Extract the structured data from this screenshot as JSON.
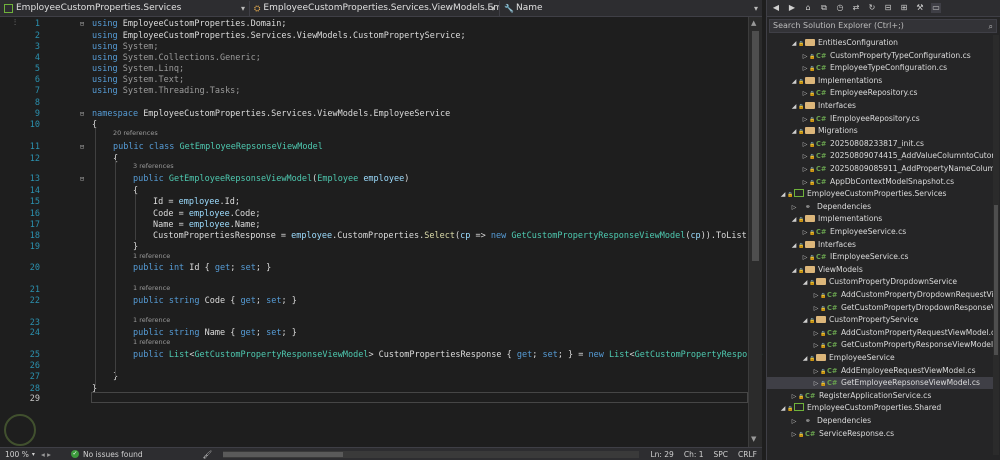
{
  "nav": {
    "project": "EmployeeCustomProperties.Services",
    "type": "EmployeeCustomProperties.Services.ViewModels.EmployeeServi",
    "member": "Name"
  },
  "code_lines": [
    {
      "n": "1",
      "parts": [
        [
          "k",
          "using "
        ],
        [
          "d",
          "EmployeeCustomProperties.Domain;"
        ]
      ]
    },
    {
      "n": "2",
      "parts": [
        [
          "k",
          "using "
        ],
        [
          "d",
          "EmployeeCustomProperties.Services.ViewModels.CustomPropertyService;"
        ]
      ]
    },
    {
      "n": "3",
      "parts": [
        [
          "k",
          "using "
        ],
        [
          "gray",
          "System;"
        ]
      ]
    },
    {
      "n": "4",
      "parts": [
        [
          "k",
          "using "
        ],
        [
          "gray",
          "System.Collections.Generic;"
        ]
      ]
    },
    {
      "n": "5",
      "parts": [
        [
          "k",
          "using "
        ],
        [
          "gray",
          "System.Linq;"
        ]
      ]
    },
    {
      "n": "6",
      "parts": [
        [
          "k",
          "using "
        ],
        [
          "gray",
          "System.Text;"
        ]
      ]
    },
    {
      "n": "7",
      "parts": [
        [
          "k",
          "using "
        ],
        [
          "gray",
          "System.Threading.Tasks;"
        ]
      ]
    },
    {
      "n": "8",
      "parts": []
    },
    {
      "n": "9",
      "parts": [
        [
          "k",
          "namespace "
        ],
        [
          "d",
          "EmployeeCustomProperties.Services.ViewModels.EmployeeService"
        ]
      ]
    },
    {
      "n": "10",
      "parts": [
        [
          "d",
          "{"
        ]
      ]
    },
    {
      "n": "11",
      "parts": [
        [
          "k",
          "public class "
        ],
        [
          "t",
          "GetEmployeeRepsonseViewModel"
        ]
      ]
    },
    {
      "n": "12",
      "parts": [
        [
          "d",
          "{"
        ]
      ]
    },
    {
      "n": "13",
      "parts": [
        [
          "k",
          "public "
        ],
        [
          "t",
          "GetEmployeeRepsonseViewModel"
        ],
        [
          "d",
          "("
        ],
        [
          "t",
          "Employee "
        ],
        [
          "p",
          "employee"
        ],
        [
          "d",
          ")"
        ]
      ]
    },
    {
      "n": "14",
      "parts": [
        [
          "d",
          "{"
        ]
      ]
    },
    {
      "n": "15",
      "parts": [
        [
          "d",
          "Id = "
        ],
        [
          "p",
          "employee"
        ],
        [
          "d",
          ".Id;"
        ]
      ]
    },
    {
      "n": "16",
      "parts": [
        [
          "d",
          "Code = "
        ],
        [
          "p",
          "employee"
        ],
        [
          "d",
          ".Code;"
        ]
      ]
    },
    {
      "n": "17",
      "parts": [
        [
          "d",
          "Name = "
        ],
        [
          "p",
          "employee"
        ],
        [
          "d",
          ".Name;"
        ]
      ]
    },
    {
      "n": "18",
      "parts": [
        [
          "d",
          "CustomPropertiesResponse = "
        ],
        [
          "p",
          "employee"
        ],
        [
          "d",
          ".CustomProperties."
        ],
        [
          "m",
          "Select"
        ],
        [
          "d",
          "("
        ],
        [
          "p",
          "cp"
        ],
        [
          "d",
          " => "
        ],
        [
          "k",
          "new "
        ],
        [
          "t",
          "GetCustomPropertyResponseViewModel"
        ],
        [
          "d",
          "("
        ],
        [
          "p",
          "cp"
        ],
        [
          "d",
          ")).ToList()"
        ]
      ]
    },
    {
      "n": "19",
      "parts": [
        [
          "d",
          "}"
        ]
      ]
    },
    {
      "n": "20",
      "parts": [
        [
          "k",
          "public int "
        ],
        [
          "d",
          "Id { "
        ],
        [
          "k",
          "get"
        ],
        [
          "d",
          "; "
        ],
        [
          "k",
          "set"
        ],
        [
          "d",
          "; }"
        ]
      ]
    },
    {
      "n": "21",
      "parts": []
    },
    {
      "n": "22",
      "parts": [
        [
          "k",
          "public string "
        ],
        [
          "d",
          "Code { "
        ],
        [
          "k",
          "get"
        ],
        [
          "d",
          "; "
        ],
        [
          "k",
          "set"
        ],
        [
          "d",
          "; }"
        ]
      ]
    },
    {
      "n": "23",
      "parts": []
    },
    {
      "n": "24",
      "parts": [
        [
          "k",
          "public string "
        ],
        [
          "d",
          "Name { "
        ],
        [
          "k",
          "get"
        ],
        [
          "d",
          "; "
        ],
        [
          "k",
          "set"
        ],
        [
          "d",
          "; }"
        ]
      ]
    },
    {
      "n": "25",
      "parts": [
        [
          "k",
          "public "
        ],
        [
          "t",
          "List"
        ],
        [
          "d",
          "<"
        ],
        [
          "t",
          "GetCustomPropertyResponseViewModel"
        ],
        [
          "d",
          "> CustomPropertiesResponse { "
        ],
        [
          "k",
          "get"
        ],
        [
          "d",
          "; "
        ],
        [
          "k",
          "set"
        ],
        [
          "d",
          "; } = "
        ],
        [
          "k",
          "new "
        ],
        [
          "t",
          "List"
        ],
        [
          "d",
          "<"
        ],
        [
          "t",
          "GetCustomPropertyResponse"
        ]
      ]
    },
    {
      "n": "26",
      "parts": []
    },
    {
      "n": "27",
      "parts": [
        [
          "d",
          "}"
        ]
      ]
    },
    {
      "n": "28",
      "parts": [
        [
          "d",
          "}"
        ]
      ]
    },
    {
      "n": "29",
      "parts": []
    }
  ],
  "references": {
    "class_refs": "20 references",
    "ctor_refs": "3 references",
    "id_refs": "1 reference",
    "code_refs": "1 reference",
    "name_refs": "1 reference",
    "list_refs": "1 reference"
  },
  "status": {
    "zoom": "100 %",
    "issues": "No issues found",
    "ln": "Ln: 29",
    "ch": "Ch: 1",
    "spc": "SPC",
    "crlf": "CRLF"
  },
  "explorer": {
    "search_placeholder": "Search Solution Explorer (Ctrl+;)",
    "tree": [
      {
        "label": "EntitiesConfiguration",
        "kind": "folder",
        "depth": 1,
        "tw": "◢"
      },
      {
        "label": "CustomPropertyTypeConfiguration.cs",
        "kind": "cs",
        "depth": 2,
        "tw": "▷"
      },
      {
        "label": "EmployeeTypeConfiguration.cs",
        "kind": "cs",
        "depth": 2,
        "tw": "▷"
      },
      {
        "label": "Implementations",
        "kind": "folder",
        "depth": 1,
        "tw": "◢"
      },
      {
        "label": "EmployeeRepository.cs",
        "kind": "cs",
        "depth": 2,
        "tw": "▷"
      },
      {
        "label": "Interfaces",
        "kind": "folder",
        "depth": 1,
        "tw": "◢"
      },
      {
        "label": "IEmployeeRepository.cs",
        "kind": "cs",
        "depth": 2,
        "tw": "▷"
      },
      {
        "label": "Migrations",
        "kind": "folder",
        "depth": 1,
        "tw": "◢"
      },
      {
        "label": "20250808233817_init.cs",
        "kind": "cs",
        "depth": 2,
        "tw": "▷"
      },
      {
        "label": "20250809074415_AddValueColumntoCutomP",
        "kind": "cs",
        "depth": 2,
        "tw": "▷"
      },
      {
        "label": "20250809085911_AddPropertyNameColumnt",
        "kind": "cs",
        "depth": 2,
        "tw": "▷"
      },
      {
        "label": "AppDbContextModelSnapshot.cs",
        "kind": "cs",
        "depth": 2,
        "tw": "▷"
      },
      {
        "label": "EmployeeCustomProperties.Services",
        "kind": "proj",
        "depth": 0,
        "tw": "◢"
      },
      {
        "label": "Dependencies",
        "kind": "dep",
        "depth": 1,
        "tw": "▷"
      },
      {
        "label": "Implementations",
        "kind": "folder",
        "depth": 1,
        "tw": "◢"
      },
      {
        "label": "EmployeeService.cs",
        "kind": "cs",
        "depth": 2,
        "tw": "▷"
      },
      {
        "label": "Interfaces",
        "kind": "folder",
        "depth": 1,
        "tw": "◢"
      },
      {
        "label": "IEmployeeService.cs",
        "kind": "cs",
        "depth": 2,
        "tw": "▷"
      },
      {
        "label": "ViewModels",
        "kind": "folder",
        "depth": 1,
        "tw": "◢"
      },
      {
        "label": "CustomPropertyDropdownService",
        "kind": "folder",
        "depth": 2,
        "tw": "◢"
      },
      {
        "label": "AddCustomPropertyDropdownRequestVie",
        "kind": "cs",
        "depth": 3,
        "tw": "▷"
      },
      {
        "label": "GetCustomPropertyDropdownResponseVi",
        "kind": "cs",
        "depth": 3,
        "tw": "▷"
      },
      {
        "label": "CustomPropertyService",
        "kind": "folder",
        "depth": 2,
        "tw": "◢"
      },
      {
        "label": "AddCustomPropertyRequestViewModel.cs",
        "kind": "cs",
        "depth": 3,
        "tw": "▷"
      },
      {
        "label": "GetCustomPropertyResponseViewModel.cs",
        "kind": "cs",
        "depth": 3,
        "tw": "▷"
      },
      {
        "label": "EmployeeService",
        "kind": "folder",
        "depth": 2,
        "tw": "◢"
      },
      {
        "label": "AddEmployeeRequestViewModel.cs",
        "kind": "cs",
        "depth": 3,
        "tw": "▷"
      },
      {
        "label": "GetEmployeeRepsonseViewModel.cs",
        "kind": "cs",
        "depth": 3,
        "tw": "▷",
        "selected": true
      },
      {
        "label": "RegisterApplicationService.cs",
        "kind": "cs",
        "depth": 1,
        "tw": "▷"
      },
      {
        "label": "EmployeeCustomProperties.Shared",
        "kind": "proj",
        "depth": 0,
        "tw": "◢"
      },
      {
        "label": "Dependencies",
        "kind": "dep",
        "depth": 1,
        "tw": "▷"
      },
      {
        "label": "ServiceResponse.cs",
        "kind": "cs",
        "depth": 1,
        "tw": "▷"
      }
    ]
  },
  "icons": [
    "project-icon",
    "class-icon",
    "wrench-icon",
    "search-icon",
    "folder-icon",
    "csharp-file-icon",
    "dependencies-icon",
    "lock-icon",
    "check-icon",
    "brush-icon"
  ]
}
